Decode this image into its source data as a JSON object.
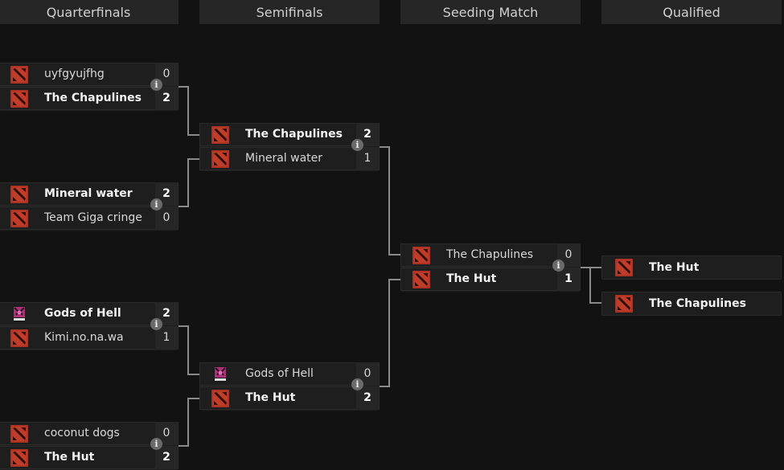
{
  "rounds": [
    {
      "label": "Quarterfinals"
    },
    {
      "label": "Semifinals"
    },
    {
      "label": "Seeding Match"
    },
    {
      "label": "Qualified"
    }
  ],
  "colors": {
    "background": "#121212",
    "header_bg": "#262626",
    "match_bg": "#1e1e1e",
    "connector": "#8a8a8a",
    "dota_logo": "#c23c2a",
    "info_badge": "#6a6a6a"
  },
  "matches": {
    "qf1": {
      "team1": {
        "name": "uyfgyujfhg",
        "score": "0",
        "winner": false,
        "logo": "dota-logo"
      },
      "team2": {
        "name": "The Chapulines",
        "score": "2",
        "winner": true,
        "logo": "dota-logo"
      },
      "info_icon": "i"
    },
    "qf2": {
      "team1": {
        "name": "Mineral water",
        "score": "2",
        "winner": true,
        "logo": "dota-logo"
      },
      "team2": {
        "name": "Team Giga cringe",
        "score": "0",
        "winner": false,
        "logo": "dota-logo"
      },
      "info_icon": "i"
    },
    "qf3": {
      "team1": {
        "name": "Gods of Hell",
        "score": "2",
        "winner": true,
        "logo": "gods-of-hell-logo"
      },
      "team2": {
        "name": "Kimi.no.na.wa",
        "score": "1",
        "winner": false,
        "logo": "dota-logo"
      },
      "info_icon": "i"
    },
    "qf4": {
      "team1": {
        "name": "coconut dogs",
        "score": "0",
        "winner": false,
        "logo": "dota-logo"
      },
      "team2": {
        "name": "The Hut",
        "score": "2",
        "winner": true,
        "logo": "dota-logo"
      },
      "info_icon": "i"
    },
    "sf1": {
      "team1": {
        "name": "The Chapulines",
        "score": "2",
        "winner": true,
        "logo": "dota-logo"
      },
      "team2": {
        "name": "Mineral water",
        "score": "1",
        "winner": false,
        "logo": "dota-logo"
      },
      "info_icon": "i"
    },
    "sf2": {
      "team1": {
        "name": "Gods of Hell",
        "score": "0",
        "winner": false,
        "logo": "gods-of-hell-logo"
      },
      "team2": {
        "name": "The Hut",
        "score": "2",
        "winner": true,
        "logo": "dota-logo"
      },
      "info_icon": "i"
    },
    "seed": {
      "team1": {
        "name": "The Chapulines",
        "score": "0",
        "winner": false,
        "logo": "dota-logo"
      },
      "team2": {
        "name": "The Hut",
        "score": "1",
        "winner": true,
        "logo": "dota-logo"
      },
      "info_icon": "i"
    }
  },
  "qualified": [
    {
      "name": "The Hut",
      "logo": "dota-logo"
    },
    {
      "name": "The Chapulines",
      "logo": "dota-logo"
    }
  ]
}
